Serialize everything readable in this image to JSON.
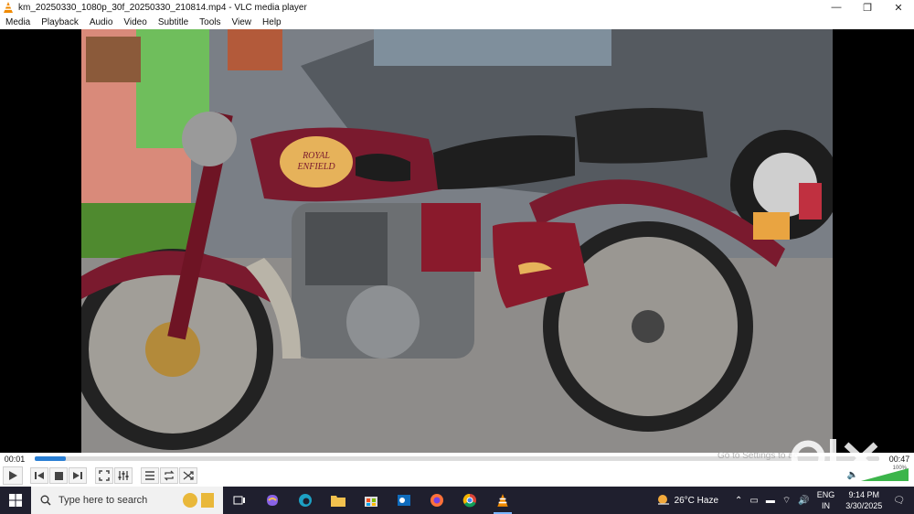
{
  "window": {
    "title": "km_20250330_1080p_30f_20250330_210814.mp4 - VLC media player",
    "controls": {
      "minimize": "—",
      "maximize": "❐",
      "close": "✕"
    }
  },
  "menu": [
    "Media",
    "Playback",
    "Audio",
    "Video",
    "Subtitle",
    "Tools",
    "View",
    "Help"
  ],
  "video": {
    "tank_badge_line1": "ROYAL",
    "tank_badge_line2": "ENFIELD"
  },
  "playback": {
    "elapsed": "00:01",
    "total": "00:47",
    "progress_fraction": 0.037
  },
  "volume": {
    "label": "100%",
    "level_percent": 100
  },
  "overlay": {
    "activate_text": "Go to Settings to ac",
    "logo_text": "OLX"
  },
  "taskbar": {
    "search_placeholder": "Type here to search",
    "weather": "26°C  Haze",
    "language_top": "ENG",
    "language_bottom": "IN",
    "time": "9:14 PM",
    "date": "3/30/2025"
  },
  "colors": {
    "seek_fill": "#2a7fd4",
    "taskbar": "#1f1f2e",
    "bike_maroon": "#7a1a2e"
  },
  "icons": {
    "play": "play-icon",
    "prev": "skip-back-icon",
    "stop": "stop-icon",
    "next": "skip-forward-icon",
    "fullscreen": "fullscreen-icon",
    "extended": "equalizer-icon",
    "playlist": "playlist-icon",
    "loop": "loop-icon",
    "random": "shuffle-icon"
  }
}
